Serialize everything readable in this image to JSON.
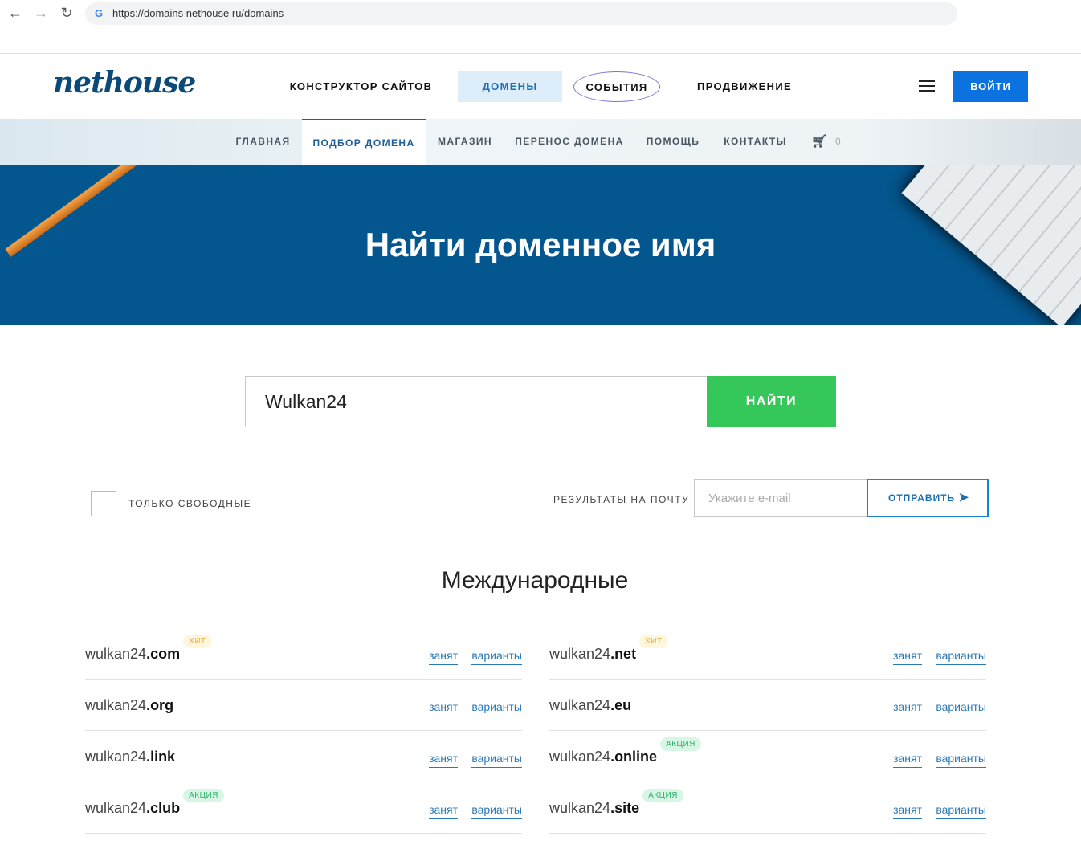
{
  "browser": {
    "url": "https://domains nethouse ru/domains"
  },
  "header": {
    "logo": "nethouse",
    "nav": [
      "КОНСТРУКТОР САЙТОВ",
      "ДОМЕНЫ",
      "СОБЫТИЯ",
      "ПРОДВИЖЕНИЕ"
    ],
    "login": "ВОЙТИ"
  },
  "subnav": {
    "items": [
      "ГЛАВНАЯ",
      "ПОДБОР ДОМЕНА",
      "МАГАЗИН",
      "ПЕРЕНОС ДОМЕНА",
      "ПОМОЩЬ",
      "КОНТАКТЫ"
    ],
    "cart_count": "0"
  },
  "hero": {
    "title": "Найти доменное имя"
  },
  "search": {
    "value": "Wulkan24",
    "button": "НАЙТИ"
  },
  "filters": {
    "only_free": "ТОЛЬКО СВОБОДНЫЕ",
    "results_label": "РЕЗУЛЬТАТЫ НА ПОЧТУ",
    "email_placeholder": "Укажите e-mail",
    "send": "ОТПРАВИТЬ"
  },
  "section": {
    "title": "Международные"
  },
  "domains": [
    {
      "name": "wulkan24",
      "tld": ".com",
      "badge": "ХИТ",
      "badge_type": "hit",
      "status": "занят",
      "variants": "варианты"
    },
    {
      "name": "wulkan24",
      "tld": ".net",
      "badge": "ХИТ",
      "badge_type": "hit",
      "status": "занят",
      "variants": "варианты"
    },
    {
      "name": "wulkan24",
      "tld": ".org",
      "badge": "",
      "badge_type": "",
      "status": "занят",
      "variants": "варианты"
    },
    {
      "name": "wulkan24",
      "tld": ".eu",
      "badge": "",
      "badge_type": "",
      "status": "занят",
      "variants": "варианты"
    },
    {
      "name": "wulkan24",
      "tld": ".link",
      "badge": "",
      "badge_type": "",
      "status": "занят",
      "variants": "варианты"
    },
    {
      "name": "wulkan24",
      "tld": ".online",
      "badge": "АКЦИЯ",
      "badge_type": "promo",
      "status": "занят",
      "variants": "варианты"
    },
    {
      "name": "wulkan24",
      "tld": ".club",
      "badge": "АКЦИЯ",
      "badge_type": "promo",
      "status": "занят",
      "variants": "варианты"
    },
    {
      "name": "wulkan24",
      "tld": ".site",
      "badge": "АКЦИЯ",
      "badge_type": "promo",
      "status": "занят",
      "variants": "варианты"
    }
  ]
}
